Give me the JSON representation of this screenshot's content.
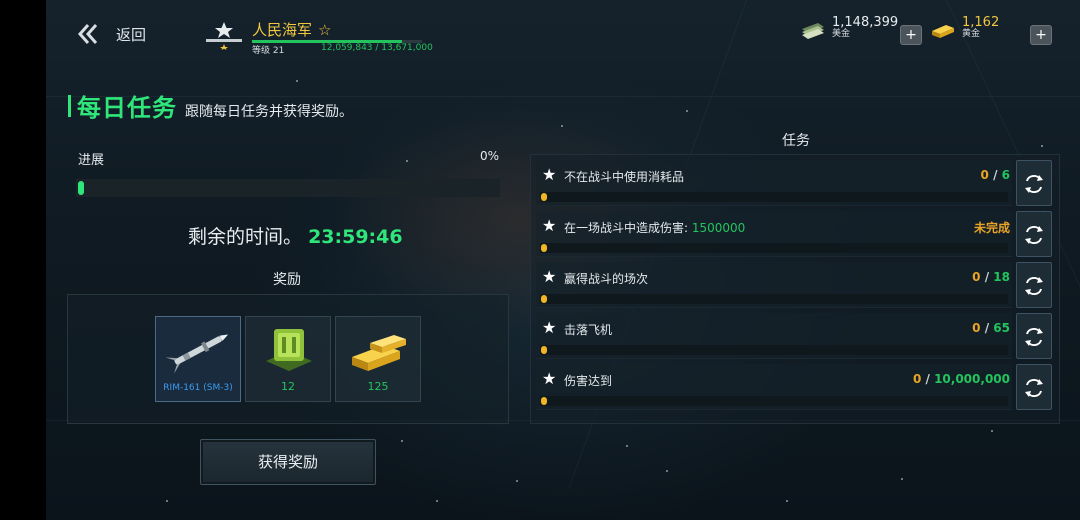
{
  "header": {
    "back_label": "返回",
    "player_name": "人民海军",
    "level_label": "等级 21",
    "xp_text": "12,059,843 / 13,671,000",
    "xp_progress": 0.882
  },
  "currencies": [
    {
      "icon": "dollar-bills-icon",
      "value": "1,148,399",
      "name": "美金"
    },
    {
      "icon": "gold-bars-icon",
      "value": "1,162",
      "name": "黄金"
    }
  ],
  "daily": {
    "title": "每日任务",
    "subtitle": "跟随每日任务并获得奖励。",
    "progress_label": "进展",
    "progress_pct": "0%",
    "time_label": "剩余的时间。",
    "time_value": "23:59:46",
    "reward_title": "奖励",
    "rewards": [
      {
        "icon": "missile-icon",
        "label": "RIM-161 (SM-3)"
      },
      {
        "icon": "green-crate-icon",
        "label": "12"
      },
      {
        "icon": "gold-bars-icon",
        "label": "125"
      }
    ],
    "claim_label": "获得奖励"
  },
  "missions_title": "任务",
  "missions": [
    {
      "label": "不在战斗中使用消耗品",
      "label_extra": "",
      "current": "0",
      "sep": "/",
      "target": "6",
      "status": ""
    },
    {
      "label": "在一场战斗中造成伤害: ",
      "label_extra": "1500000",
      "current": "",
      "sep": "",
      "target": "",
      "status": "未完成"
    },
    {
      "label": "赢得战斗的场次",
      "label_extra": "",
      "current": "0",
      "sep": "/",
      "target": "18",
      "status": ""
    },
    {
      "label": "击落飞机",
      "label_extra": "",
      "current": "0",
      "sep": "/",
      "target": "65",
      "status": ""
    },
    {
      "label": "伤害达到",
      "label_extra": "",
      "current": "0",
      "sep": "/",
      "target": "10,000,000",
      "status": ""
    }
  ],
  "colors": {
    "accent_green": "#2ee67a",
    "gold": "#f1c640",
    "orange": "#e9a427"
  }
}
